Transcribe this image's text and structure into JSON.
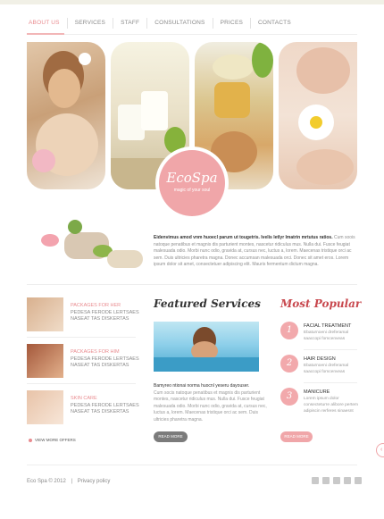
{
  "nav": {
    "items": [
      "About us",
      "Services",
      "Staff",
      "Consultations",
      "Prices",
      "Contacts"
    ],
    "active": "About us"
  },
  "logo": {
    "title": "EcoSpa",
    "tagline": "magic of your soul"
  },
  "intro": {
    "lead": "Eidenvimus amod vnm huoecl parum ut tougetris. Ivelis letlyr lmatrin mrtutus ratios.",
    "body": "Cum soois natoque penatibus et magnis dis parturient montes, nascetur ridiculus mus. Nulla dui. Fusce feugiat malesuada odio. Morbi nunc odio, gravida at, cursus nec, luctus a, lorem. Maecenas tristique orci ac sem. Duis ultricies pharetra magna. Donec accumsan malesuada orci. Donec sit amet eros. Lorem ipsum dolor sit amet, consectetuer adipiscing elit. Mauris fermentum dictum magna."
  },
  "packages": [
    {
      "title": "Packages for her",
      "lines": [
        "Pedesa ferode lertsaes",
        "Naseat tas diskertas"
      ]
    },
    {
      "title": "Packages for him",
      "lines": [
        "Pedesa ferode lertsaes",
        "Naseat tas diskertas"
      ]
    },
    {
      "title": "Skin care",
      "lines": [
        "Pedesa ferode lertsaes",
        "Naseat tas diskertas"
      ]
    }
  ],
  "view_more": "View more offers",
  "featured": {
    "title": "Featured Services",
    "lead": "Bamyreo ntionai norma huocnl yeseru dayouser.",
    "body": "Cum socis natoque penatibus et magnis dis parturient montes, nascetur ridiculus mus. Nulla dui. Fusce feugiat malesuada odio. Morbi nunc odio, gravida at, cursus nec, luctus a, lorem. Maecenas tristique orci ac sem. Duis ultricies pharetra magna.",
    "button": "Read more"
  },
  "popular": {
    "title": "Most Popular",
    "items": [
      {
        "num": "1",
        "name": "Facial treatment",
        "desc": "Ebaturnoeni dreferamal saaccopi fomcenveas"
      },
      {
        "num": "2",
        "name": "Hair design",
        "desc": "Ebaturnoeni dreferamal saaccopi fomcenveas"
      },
      {
        "num": "3",
        "name": "Manicure",
        "desc": "Lorem ipsum dolor consecteturre alibore pertem adipiscin rerferes sinaesnt"
      }
    ],
    "button": "Read more"
  },
  "footer": {
    "copyright": "Eco Spa © 2012",
    "separator": "|",
    "privacy": "Privacy policy"
  },
  "social_icons": [
    "facebook-icon",
    "flickr-icon",
    "twitter-icon",
    "rss-icon",
    "home-icon"
  ],
  "colors": {
    "accent": "#e98b8f",
    "logo_pink": "#f0a6a9",
    "popular_title": "#c8484e",
    "dark_button": "#7b7b7b"
  }
}
